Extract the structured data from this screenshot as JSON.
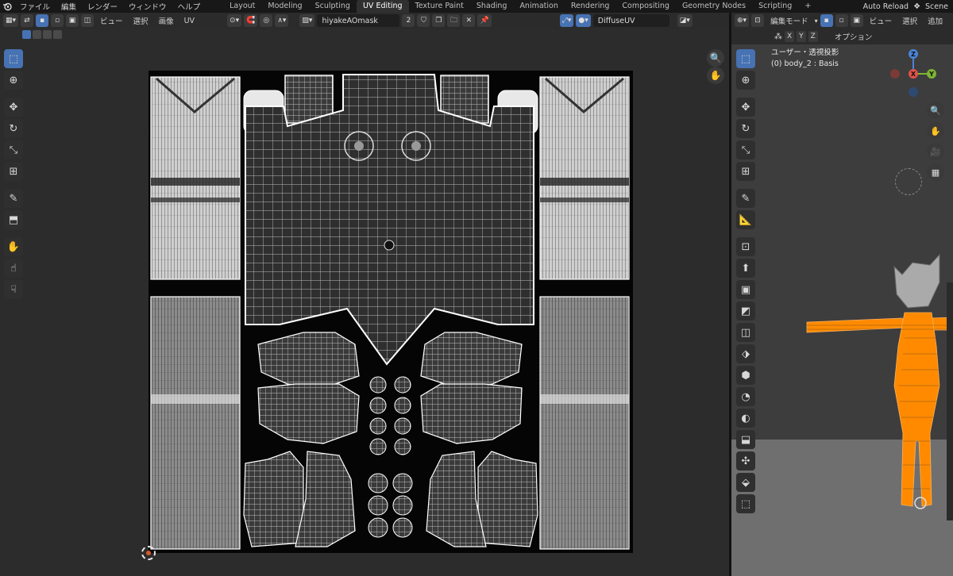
{
  "topbar": {
    "logo_icon": "blender-logo",
    "menus": [
      "ファイル",
      "編集",
      "レンダー",
      "ウィンドウ",
      "ヘルプ"
    ],
    "workspaces": [
      {
        "label": "Layout",
        "active": false
      },
      {
        "label": "Modeling",
        "active": false
      },
      {
        "label": "Sculpting",
        "active": false
      },
      {
        "label": "UV Editing",
        "active": true
      },
      {
        "label": "Texture Paint",
        "active": false
      },
      {
        "label": "Shading",
        "active": false
      },
      {
        "label": "Animation",
        "active": false
      },
      {
        "label": "Rendering",
        "active": false
      },
      {
        "label": "Compositing",
        "active": false
      },
      {
        "label": "Geometry Nodes",
        "active": false
      },
      {
        "label": "Scripting",
        "active": false
      }
    ],
    "add_tab": "+",
    "auto_reload": "Auto Reload",
    "scene": "Scene"
  },
  "uv_editor": {
    "menu_view": "ビュー",
    "menu_select": "選択",
    "menu_image": "画像",
    "menu_uv": "UV",
    "image_name": "hiyakeAOmask",
    "users_count": "2",
    "uv_map": "DiffuseUV"
  },
  "viewport": {
    "mode": "編集モード",
    "menu_view": "ビュー",
    "menu_select": "選択",
    "menu_add": "追加",
    "axes": [
      "X",
      "Y",
      "Z"
    ],
    "options": "オプション",
    "view_label": "ユーザー・透視投影",
    "object_label": "(0) body_2 : Basis",
    "gizmo_axes": {
      "x": "X",
      "y": "Y",
      "z": "Z"
    }
  },
  "colors": {
    "accent": "#4772b3",
    "selection": "#ff8a00",
    "axis_x": "#e0524a",
    "axis_y": "#7db332",
    "axis_z": "#4a84d8"
  }
}
